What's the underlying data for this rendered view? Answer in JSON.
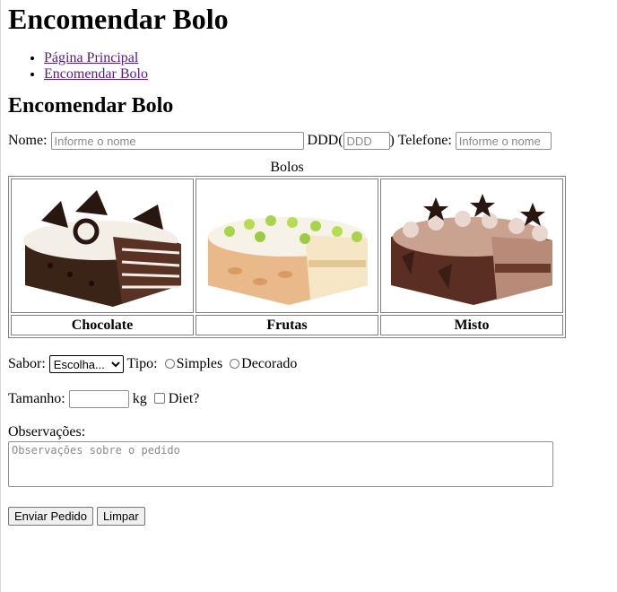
{
  "header": {
    "title": "Encomendar Bolo"
  },
  "nav": {
    "items": [
      "Página Principal",
      "Encomendar Bolo"
    ]
  },
  "section_title": "Encomendar Bolo",
  "form": {
    "nome_label": "Nome:",
    "nome_placeholder": "Informe o nome",
    "ddd_label_open": "DDD(",
    "ddd_placeholder": "DDD",
    "ddd_label_close": ")",
    "telefone_label": "Telefone:",
    "telefone_placeholder": "Informe o nome",
    "sabor_label": "Sabor:",
    "sabor_selected": "Escolha...",
    "tipo_label": "Tipo:",
    "tipo_options": [
      "Simples",
      "Decorado"
    ],
    "tamanho_label": "Tamanho:",
    "tamanho_unit": "kg",
    "diet_label": "Diet?",
    "obs_label": "Observações:",
    "obs_placeholder": "Observações sobre o pedido"
  },
  "table": {
    "caption": "Bolos",
    "cakes": [
      {
        "name": "Chocolate",
        "image": "chocolate-cake-image"
      },
      {
        "name": "Frutas",
        "image": "fruit-cake-image"
      },
      {
        "name": "Misto",
        "image": "mixed-cake-image"
      }
    ]
  },
  "buttons": {
    "submit": "Enviar Pedido",
    "reset": "Limpar"
  }
}
